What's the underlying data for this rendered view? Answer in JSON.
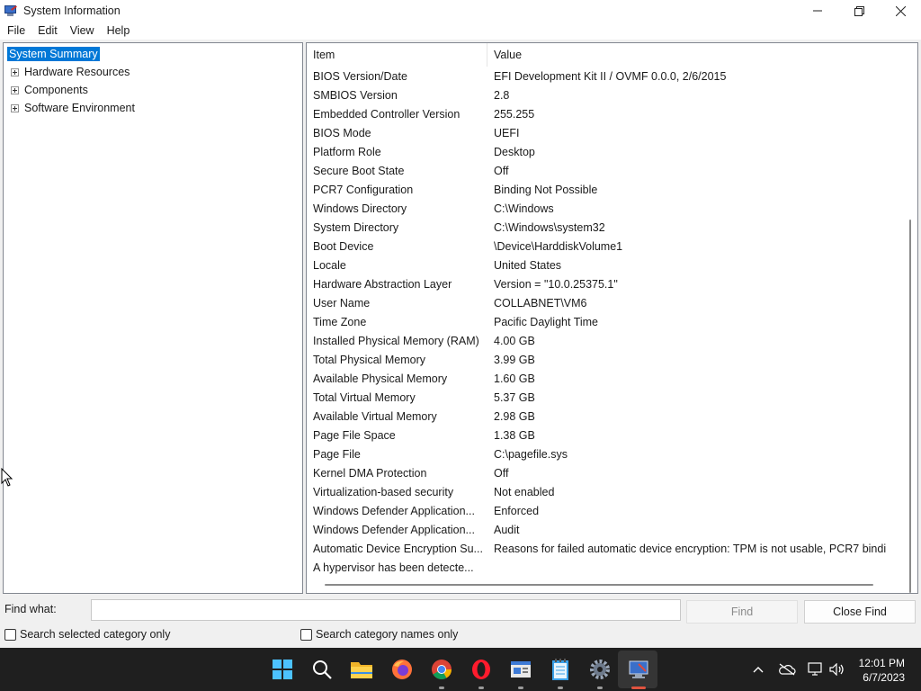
{
  "window": {
    "title": "System Information",
    "minimize_label": "—",
    "maximize_label": "❐",
    "close_label": "✕"
  },
  "menu": [
    "File",
    "Edit",
    "View",
    "Help"
  ],
  "tree": {
    "items": [
      {
        "label": "System Summary",
        "selected": true,
        "expandable": false
      },
      {
        "label": "Hardware Resources",
        "selected": false,
        "expandable": true
      },
      {
        "label": "Components",
        "selected": false,
        "expandable": true
      },
      {
        "label": "Software Environment",
        "selected": false,
        "expandable": true
      }
    ]
  },
  "list": {
    "columns": [
      "Item",
      "Value"
    ],
    "rows": [
      [
        "BIOS Version/Date",
        "EFI Development Kit II / OVMF 0.0.0, 2/6/2015"
      ],
      [
        "SMBIOS Version",
        "2.8"
      ],
      [
        "Embedded Controller Version",
        "255.255"
      ],
      [
        "BIOS Mode",
        "UEFI"
      ],
      [
        "Platform Role",
        "Desktop"
      ],
      [
        "Secure Boot State",
        "Off"
      ],
      [
        "PCR7 Configuration",
        "Binding Not Possible"
      ],
      [
        "Windows Directory",
        "C:\\Windows"
      ],
      [
        "System Directory",
        "C:\\Windows\\system32"
      ],
      [
        "Boot Device",
        "\\Device\\HarddiskVolume1"
      ],
      [
        "Locale",
        "United States"
      ],
      [
        "Hardware Abstraction Layer",
        "Version = \"10.0.25375.1\""
      ],
      [
        "User Name",
        "COLLABNET\\VM6"
      ],
      [
        "Time Zone",
        "Pacific Daylight Time"
      ],
      [
        "Installed Physical Memory (RAM)",
        "4.00 GB"
      ],
      [
        "Total Physical Memory",
        "3.99 GB"
      ],
      [
        "Available Physical Memory",
        "1.60 GB"
      ],
      [
        "Total Virtual Memory",
        "5.37 GB"
      ],
      [
        "Available Virtual Memory",
        "2.98 GB"
      ],
      [
        "Page File Space",
        "1.38 GB"
      ],
      [
        "Page File",
        "C:\\pagefile.sys"
      ],
      [
        "Kernel DMA Protection",
        "Off"
      ],
      [
        "Virtualization-based security",
        "Not enabled"
      ],
      [
        "Windows Defender Application...",
        "Enforced"
      ],
      [
        "Windows Defender Application...",
        "Audit"
      ],
      [
        "Automatic Device Encryption Su...",
        "Reasons for failed automatic device encryption: TPM is not usable, PCR7 bindi"
      ],
      [
        "A hypervisor has been detecte...",
        ""
      ]
    ]
  },
  "find": {
    "label": "Find what:",
    "value": "",
    "placeholder": "",
    "find_button": "Find",
    "close_find_button": "Close Find",
    "search_selected_category": "Search selected category only",
    "search_category_names": "Search category names only"
  },
  "taskbar": {
    "apps": [
      "start-icon",
      "search-icon",
      "file-explorer-icon",
      "firefox-icon",
      "chrome-icon",
      "opera-icon",
      "news-app-icon",
      "notepad-icon",
      "settings-icon",
      "system-information-icon"
    ],
    "time": "12:01 PM",
    "date": "6/7/2023"
  },
  "colors": {
    "selection": "#0078d7",
    "taskbar": "#1f1f1f",
    "active_indicator": "#e0533f"
  }
}
